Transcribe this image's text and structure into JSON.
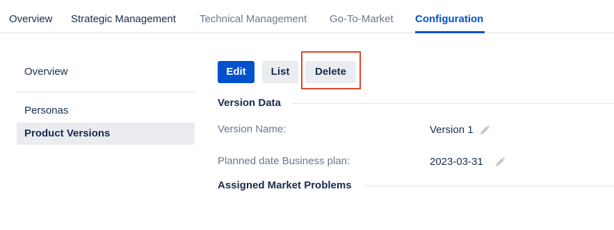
{
  "tabs": [
    {
      "label": "Overview"
    },
    {
      "label": "Strategic Management"
    },
    {
      "label": "Technical Management"
    },
    {
      "label": "Go-To-Market"
    },
    {
      "label": "Configuration",
      "active": true
    }
  ],
  "sidebar": {
    "items": [
      {
        "label": "Overview"
      },
      {
        "label": "Personas"
      },
      {
        "label": "Product Versions",
        "selected": true
      }
    ]
  },
  "toolbar": {
    "edit_label": "Edit",
    "list_label": "List",
    "delete_label": "Delete"
  },
  "version_data": {
    "heading": "Version Data",
    "fields": [
      {
        "label": "Version Name:",
        "value": "Version 1",
        "icon": "pencil-icon"
      },
      {
        "label": "Planned date Business plan:",
        "value": "2023-03-31",
        "icon": "pencil-icon"
      }
    ]
  },
  "assigned_market_problems": {
    "heading": "Assigned Market Problems"
  },
  "colors": {
    "accent": "#0052cc",
    "highlight": "#d9452b",
    "button_default": "#ebecf0"
  }
}
